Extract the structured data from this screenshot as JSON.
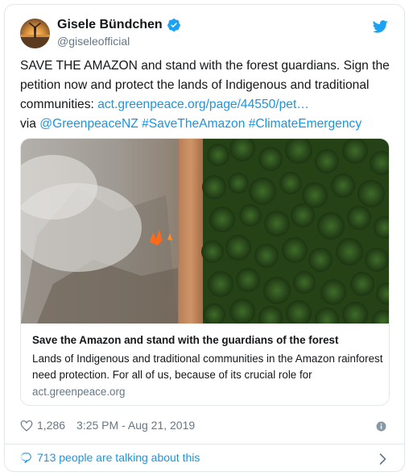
{
  "author": {
    "display_name": "Gisele Bündchen",
    "handle": "@giseleofficial",
    "verified": true
  },
  "tweet": {
    "text_main": "SAVE THE AMAZON and stand with the forest guardians. Sign the petition now and protect the lands of Indigenous and traditional communities: ",
    "link_text": "act.greenpeace.org/page/44550/pet…",
    "via_label": "via",
    "mention": "@GreenpeaceNZ",
    "hashtags": [
      "#SaveTheAmazon",
      "#ClimateEmergency"
    ]
  },
  "card": {
    "title": "Save the Amazon and stand with the guardians of the forest",
    "description": "Lands of Indigenous and traditional communities in the Amazon rainforest need protection. For all of us, because of its crucial role for",
    "domain": "act.greenpeace.org"
  },
  "meta": {
    "likes": "1,286",
    "timestamp": "3:25 PM - Aug 21, 2019"
  },
  "footer": {
    "talking_label": "713 people are talking about this"
  },
  "icons": {
    "verified": "verified-badge-icon",
    "bird": "twitter-bird-icon",
    "heart": "heart-icon",
    "info": "info-icon",
    "bubble": "speech-bubble-icon",
    "chevron": "chevron-right-icon"
  },
  "colors": {
    "link": "#1b95e0",
    "text": "#14171a",
    "muted": "#657786",
    "border": "#e1e8ed"
  }
}
